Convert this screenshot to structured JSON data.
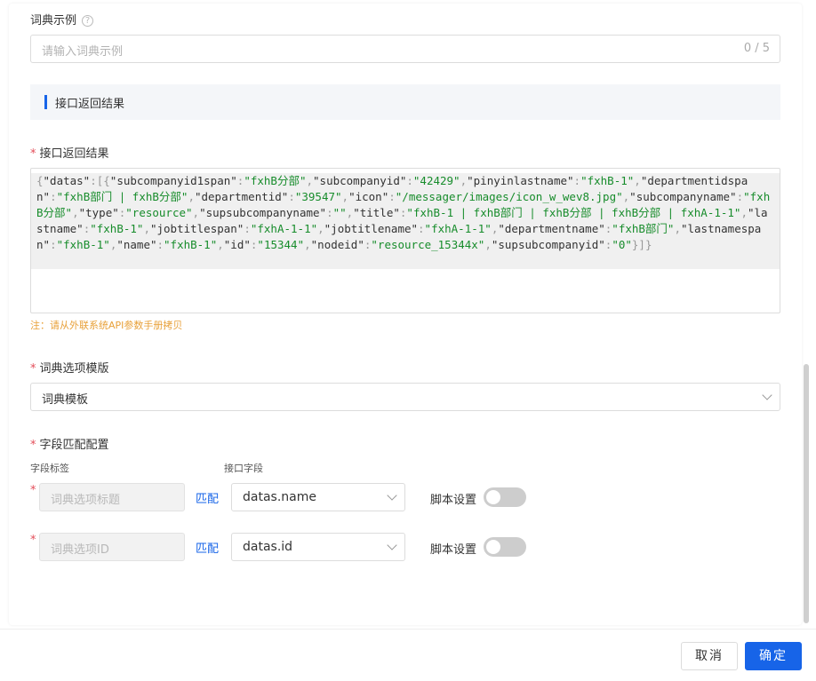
{
  "form": {
    "dict_example": {
      "label": "词典示例",
      "help_icon": "?",
      "placeholder": "请输入词典示例",
      "counter": "0 / 5"
    },
    "section_title": "接口返回结果",
    "api_result": {
      "label": "接口返回结果",
      "required_mark": "*",
      "note": "注：请从外联系统API参数手册拷贝"
    },
    "template": {
      "label": "词典选项模版",
      "required_mark": "*",
      "value": "词典模板"
    },
    "field_mapping": {
      "label": "字段匹配配置",
      "required_mark": "*",
      "col_field_label": "字段标签",
      "col_api_field": "接口字段",
      "rows": [
        {
          "required_mark": "*",
          "placeholder": "词典选项标题",
          "match_label": "匹配",
          "api_field": "datas.name",
          "script_label": "脚本设置"
        },
        {
          "required_mark": "*",
          "placeholder": "词典选项ID",
          "match_label": "匹配",
          "api_field": "datas.id",
          "script_label": "脚本设置"
        }
      ]
    }
  },
  "json_tokens": [
    [
      "p",
      "{"
    ],
    [
      "k",
      "\"datas\""
    ],
    [
      "p",
      ":[{"
    ],
    [
      "k",
      "\"subcompanyid1span\""
    ],
    [
      "p",
      ":"
    ],
    [
      "s",
      "\"fxhB分部\""
    ],
    [
      "p",
      ","
    ],
    [
      "k",
      "\"subcompanyid\""
    ],
    [
      "p",
      ":"
    ],
    [
      "s",
      "\"42429\""
    ],
    [
      "p",
      ","
    ],
    [
      "k",
      "\"pinyinlastname\""
    ],
    [
      "p",
      ":"
    ],
    [
      "s",
      "\"fxhB-1\""
    ],
    [
      "p",
      ","
    ],
    [
      "k",
      "\"departmentidspan\""
    ],
    [
      "p",
      ":"
    ],
    [
      "s",
      "\"fxhB部门 | fxhB分部\""
    ],
    [
      "p",
      ","
    ],
    [
      "k",
      "\"departmentid\""
    ],
    [
      "p",
      ":"
    ],
    [
      "s",
      "\"39547\""
    ],
    [
      "p",
      ","
    ],
    [
      "k",
      "\"icon\""
    ],
    [
      "p",
      ":"
    ],
    [
      "s",
      "\"/messager/images/icon_w_wev8.jpg\""
    ],
    [
      "p",
      ","
    ],
    [
      "k",
      "\"subcompanyname\""
    ],
    [
      "p",
      ":"
    ],
    [
      "s",
      "\"fxhB分部\""
    ],
    [
      "p",
      ","
    ],
    [
      "k",
      "\"type\""
    ],
    [
      "p",
      ":"
    ],
    [
      "s",
      "\"resource\""
    ],
    [
      "p",
      ","
    ],
    [
      "k",
      "\"supsubcompanyname\""
    ],
    [
      "p",
      ":"
    ],
    [
      "s",
      "\"\""
    ],
    [
      "p",
      ","
    ],
    [
      "k",
      "\"title\""
    ],
    [
      "p",
      ":"
    ],
    [
      "s",
      "\"fxhB-1 | fxhB部门 | fxhB分部 | fxhB分部 | fxhA-1-1\""
    ],
    [
      "p",
      ","
    ],
    [
      "k",
      "\"lastname\""
    ],
    [
      "p",
      ":"
    ],
    [
      "s",
      "\"fxhB-1\""
    ],
    [
      "p",
      ","
    ],
    [
      "k",
      "\"jobtitlespan\""
    ],
    [
      "p",
      ":"
    ],
    [
      "s",
      "\"fxhA-1-1\""
    ],
    [
      "p",
      ","
    ],
    [
      "k",
      "\"jobtitlename\""
    ],
    [
      "p",
      ":"
    ],
    [
      "s",
      "\"fxhA-1-1\""
    ],
    [
      "p",
      ","
    ],
    [
      "k",
      "\"departmentname\""
    ],
    [
      "p",
      ":"
    ],
    [
      "s",
      "\"fxhB部门\""
    ],
    [
      "p",
      ","
    ],
    [
      "k",
      "\"lastnamespan\""
    ],
    [
      "p",
      ":"
    ],
    [
      "s",
      "\"fxhB-1\""
    ],
    [
      "p",
      ","
    ],
    [
      "k",
      "\"name\""
    ],
    [
      "p",
      ":"
    ],
    [
      "s",
      "\"fxhB-1\""
    ],
    [
      "p",
      ","
    ],
    [
      "k",
      "\"id\""
    ],
    [
      "p",
      ":"
    ],
    [
      "s",
      "\"15344\""
    ],
    [
      "p",
      ","
    ],
    [
      "k",
      "\"nodeid\""
    ],
    [
      "p",
      ":"
    ],
    [
      "s",
      "\"resource_15344x\""
    ],
    [
      "p",
      ","
    ],
    [
      "k",
      "\"supsubcompanyid\""
    ],
    [
      "p",
      ":"
    ],
    [
      "s",
      "\"0\""
    ],
    [
      "p",
      "}]}"
    ]
  ],
  "footer": {
    "cancel_label": "取消",
    "ok_label": "确定"
  }
}
